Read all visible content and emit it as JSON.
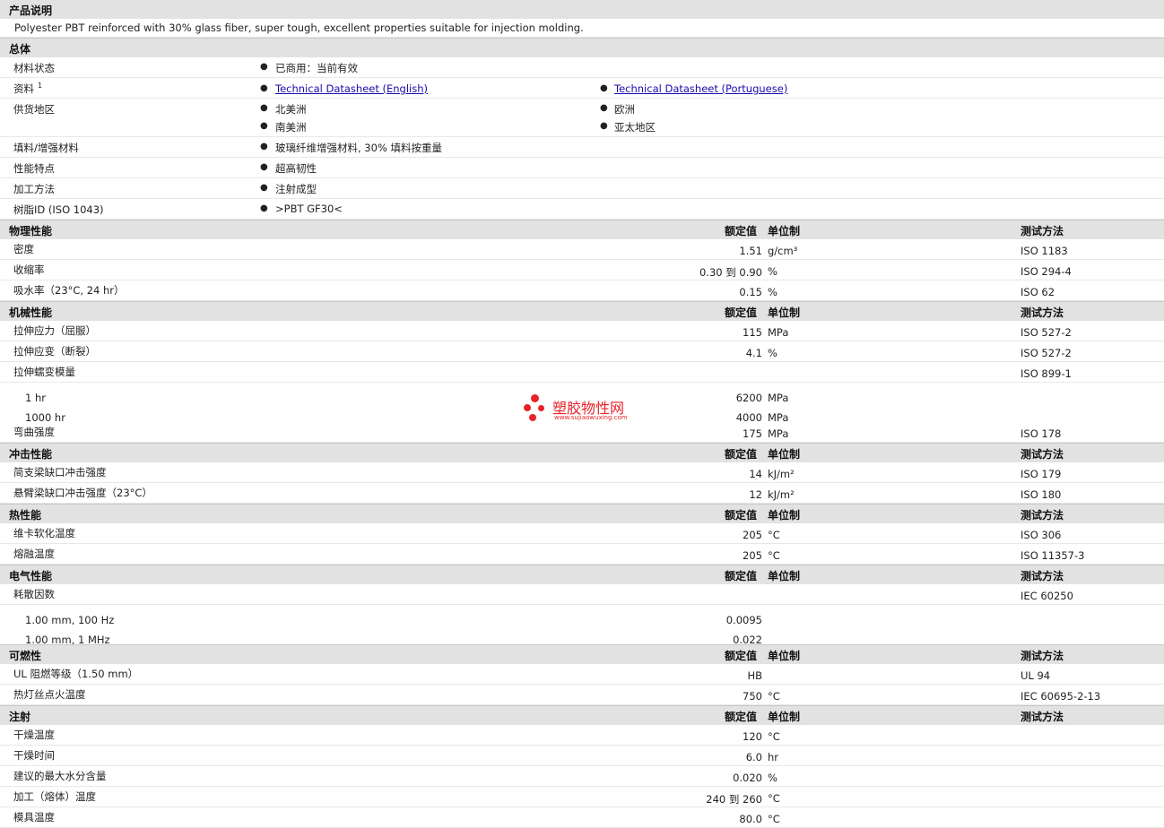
{
  "description": {
    "title": "产品说明",
    "text": "Polyester PBT reinforced with 30% glass fiber, super tough, excellent properties suitable for injection molding."
  },
  "general": {
    "title": "总体",
    "rows": [
      {
        "label": "材料状态",
        "v1": "已商用：当前有效"
      },
      {
        "label": "资料",
        "sup": "1",
        "link1": "Technical Datasheet (English)",
        "link2": "Technical Datasheet (Portuguese)"
      },
      {
        "label": "供货地区",
        "a1": "北美洲",
        "a2": "欧洲",
        "a3": "南美洲",
        "a4": "亚太地区"
      },
      {
        "label": "填料/增强材料",
        "v1": "玻璃纤维增强材料, 30% 填料按重量"
      },
      {
        "label": "性能特点",
        "v1": "超高韧性"
      },
      {
        "label": "加工方法",
        "v1": "注射成型"
      },
      {
        "label": "树脂ID (ISO 1043)",
        "v1": ">PBT GF30<"
      }
    ]
  },
  "headers": {
    "nominal": "额定值",
    "unit": "单位制",
    "method": "测试方法"
  },
  "physical": {
    "title": "物理性能",
    "rows": [
      {
        "name": "密度",
        "value": "1.51",
        "unit": "g/cm³",
        "method": "ISO 1183"
      },
      {
        "name": "收缩率",
        "value": "0.30 到  0.90",
        "unit": "%",
        "method": "ISO 294-4"
      },
      {
        "name": "吸水率（23°C, 24 hr）",
        "value": "0.15",
        "unit": "%",
        "method": "ISO 62"
      }
    ]
  },
  "mechanical": {
    "title": "机械性能",
    "rows": [
      {
        "name": "拉伸应力（屈服）",
        "value": "115",
        "unit": "MPa",
        "method": "ISO 527-2"
      },
      {
        "name": "拉伸应变（断裂）",
        "value": "4.1",
        "unit": "%",
        "method": "ISO 527-2"
      },
      {
        "name": "拉伸蠕变模量",
        "value": "",
        "unit": "",
        "method": "ISO 899-1"
      },
      {
        "name": "1 hr",
        "value": "6200",
        "unit": "MPa",
        "method": "",
        "indent": true
      },
      {
        "name": "1000 hr",
        "value": "4000",
        "unit": "MPa",
        "method": "",
        "indent": true
      },
      {
        "name": "弯曲强度",
        "value": "175",
        "unit": "MPa",
        "method": "ISO 178"
      }
    ]
  },
  "impact": {
    "title": "冲击性能",
    "rows": [
      {
        "name": "简支梁缺口冲击强度",
        "value": "14",
        "unit": "kJ/m²",
        "method": "ISO 179"
      },
      {
        "name": "悬臂梁缺口冲击强度（23°C）",
        "value": "12",
        "unit": "kJ/m²",
        "method": "ISO 180"
      }
    ]
  },
  "thermal": {
    "title": "热性能",
    "rows": [
      {
        "name": "维卡软化温度",
        "value": "205",
        "unit": "°C",
        "method": "ISO 306"
      },
      {
        "name": "熔融温度",
        "value": "205",
        "unit": "°C",
        "method": "ISO 11357-3"
      }
    ]
  },
  "electrical": {
    "title": "电气性能",
    "rows": [
      {
        "name": "耗散因数",
        "value": "",
        "unit": "",
        "method": "IEC 60250"
      },
      {
        "name": "1.00 mm, 100 Hz",
        "value": "0.0095",
        "unit": "",
        "method": "",
        "indent": true
      },
      {
        "name": "1.00 mm, 1 MHz",
        "value": "0.022",
        "unit": "",
        "method": "",
        "indent": true
      }
    ]
  },
  "flammability": {
    "title": "可燃性",
    "rows": [
      {
        "name": "UL 阻燃等级（1.50 mm）",
        "value": "HB",
        "unit": "",
        "method": "UL 94"
      },
      {
        "name": "热灯丝点火温度",
        "value": "750",
        "unit": "°C",
        "method": "IEC 60695-2-13"
      }
    ]
  },
  "injection": {
    "title": "注射",
    "rows": [
      {
        "name": "干燥温度",
        "value": "120",
        "unit": "°C",
        "method": ""
      },
      {
        "name": "干燥时间",
        "value": "6.0",
        "unit": "hr",
        "method": ""
      },
      {
        "name": "建议的最大水分含量",
        "value": "0.020",
        "unit": "%",
        "method": ""
      },
      {
        "name": "加工（熔体）温度",
        "value": "240 到  260",
        "unit": "°C",
        "method": ""
      },
      {
        "name": "模具温度",
        "value": "80.0",
        "unit": "°C",
        "method": ""
      }
    ]
  },
  "watermark": {
    "brand": "塑胶物性网",
    "url": "www.sujiaowuxing.com",
    "color": "#e8232a"
  }
}
